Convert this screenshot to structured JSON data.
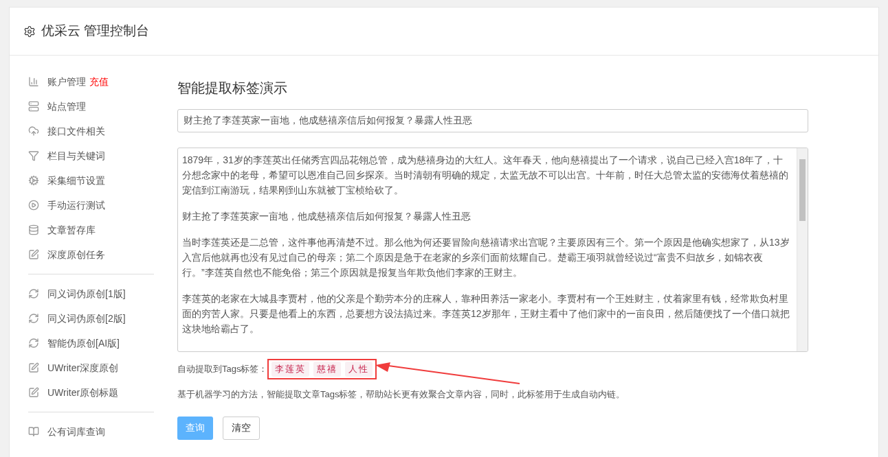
{
  "header": {
    "title": "优采云 管理控制台"
  },
  "sidebar": {
    "groups": [
      {
        "items": [
          {
            "label": "账户管理",
            "badge": "充值"
          },
          {
            "label": "站点管理"
          },
          {
            "label": "接口文件相关"
          },
          {
            "label": "栏目与关键词"
          },
          {
            "label": "采集细节设置"
          },
          {
            "label": "手动运行测试"
          },
          {
            "label": "文章暂存库"
          },
          {
            "label": "深度原创任务"
          }
        ]
      },
      {
        "items": [
          {
            "label": "同义词伪原创[1版]"
          },
          {
            "label": "同义词伪原创[2版]"
          },
          {
            "label": "智能伪原创[AI版]"
          },
          {
            "label": "UWriter深度原创"
          },
          {
            "label": "UWriter原创标题"
          }
        ]
      },
      {
        "items": [
          {
            "label": "公有词库查询"
          }
        ]
      }
    ]
  },
  "main": {
    "heading": "智能提取标签演示",
    "title_field": {
      "value": "财主抢了李莲英家一亩地，他成慈禧亲信后如何报复？暴露人性丑恶"
    },
    "content_paragraphs": [
      "1879年，31岁的李莲英出任储秀宫四品花翎总管，成为慈禧身边的大红人。这年春天，他向慈禧提出了一个请求，说自己已经入宫18年了，十分想念家中的老母，希望可以恩准自己回乡探亲。当时清朝有明确的规定，太监无故不可以出宫。十年前，时任大总管太监的安德海仗着慈禧的宠信到江南游玩，结果刚到山东就被丁宝桢给砍了。",
      "财主抢了李莲英家一亩地，他成慈禧亲信后如何报复？暴露人性丑恶",
      "当时李莲英还是二总管，这件事他再清楚不过。那么他为何还要冒险向慈禧请求出宫呢？主要原因有三个。第一个原因是他确实想家了，从13岁入宫后他就再也没有见过自己的母亲；第二个原因是急于在老家的乡亲们面前炫耀自己。楚霸王项羽就曾经说过“富贵不归故乡，如锦衣夜行。”李莲英自然也不能免俗；第三个原因就是报复当年欺负他们李家的王财主。",
      "李莲英的老家在大城县李贾村，他的父亲是个勤劳本分的庄稼人，靠种田养活一家老小。李贾村有一个王姓财主，仗着家里有钱，经常欺负村里面的穷苦人家。只要是他看上的东西，总要想方设法搞过来。李莲英12岁那年，王财主看中了他们家中的一亩良田，然后随便找了一个借口就把这块地给霸占了。"
    ],
    "tags_label": "自动提取到Tags标签：",
    "tags": [
      "李莲英",
      "慈禧",
      "人性"
    ],
    "description": "基于机器学习的方法，智能提取文章Tags标签，帮助站长更有效聚合文章内容，同时，此标签用于生成自动内链。",
    "buttons": [
      {
        "label": "查询",
        "kind": "primary"
      },
      {
        "label": "清空",
        "kind": "default"
      }
    ]
  }
}
